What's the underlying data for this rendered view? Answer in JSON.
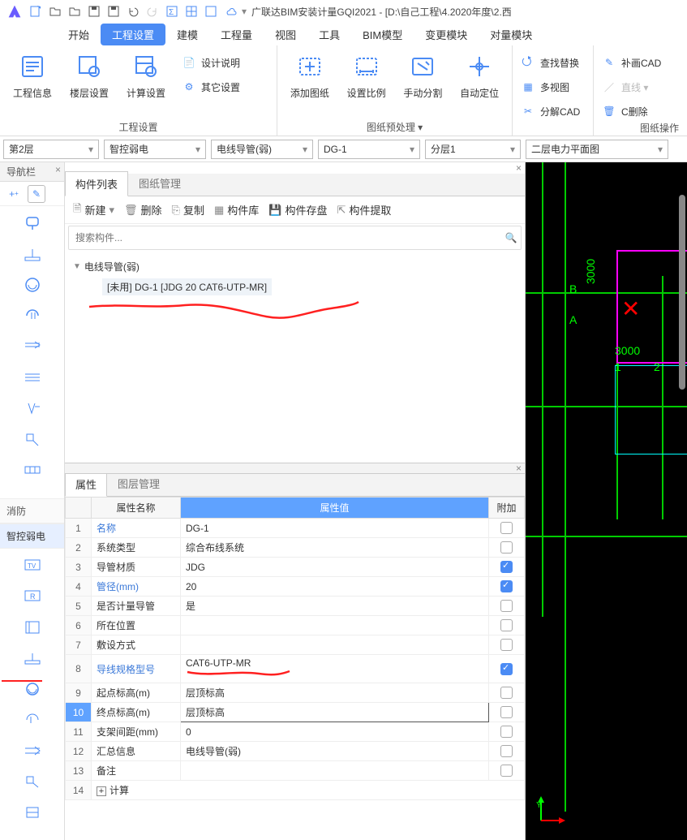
{
  "app": {
    "title": "广联达BIM安装计量GQI2021 - [D:\\自己工程\\4.2020年度\\2.西"
  },
  "menu": {
    "items": [
      "开始",
      "工程设置",
      "建模",
      "工程量",
      "视图",
      "工具",
      "BIM模型",
      "变更模块",
      "对量模块"
    ],
    "active_index": 1
  },
  "ribbon": {
    "group1": {
      "big": [
        {
          "label": "工程信息"
        },
        {
          "label": "楼层设置"
        },
        {
          "label": "计算设置"
        }
      ],
      "small": [
        {
          "label": "设计说明"
        },
        {
          "label": "其它设置"
        }
      ],
      "caption": "工程设置"
    },
    "group2": {
      "big": [
        {
          "label": "添加图纸"
        },
        {
          "label": "设置比例"
        },
        {
          "label": "手动分割"
        },
        {
          "label": "自动定位"
        }
      ],
      "caption": "图纸预处理 ▾"
    },
    "group3": {
      "small": [
        {
          "label": "查找替换"
        },
        {
          "label": "多视图"
        },
        {
          "label": "分解CAD"
        }
      ]
    },
    "group4": {
      "small": [
        {
          "label": "补画CAD"
        },
        {
          "label": "直线 ▾",
          "disabled": true
        },
        {
          "label": "C删除"
        }
      ],
      "caption": "图纸操作"
    }
  },
  "combos": {
    "c1": "第2层",
    "c2": "智控弱电",
    "c3": "电线导管(弱)",
    "c4": "DG-1",
    "c5": "分层1",
    "c6": "二层电力平面图"
  },
  "left_rail": {
    "title": "导航栏",
    "section_fire": "消防",
    "section_weak": "智控弱电"
  },
  "component_list": {
    "tabs": [
      "构件列表",
      "图纸管理"
    ],
    "toolbar": {
      "new": "新建",
      "del": "删除",
      "copy": "复制",
      "lib": "构件库",
      "save": "构件存盘",
      "extract": "构件提取"
    },
    "search_placeholder": "搜索构件...",
    "tree_root": "电线导管(弱)",
    "tree_leaf": "[未用] DG-1 [JDG 20 CAT6-UTP-MR]"
  },
  "props": {
    "tabs": [
      "属性",
      "图层管理"
    ],
    "headers": {
      "name": "属性名称",
      "value": "属性值",
      "att": "附加"
    },
    "rows": [
      {
        "idx": "1",
        "name": "名称",
        "val": "DG-1",
        "link": true,
        "chk": false
      },
      {
        "idx": "2",
        "name": "系统类型",
        "val": "综合布线系统",
        "chk": false
      },
      {
        "idx": "3",
        "name": "导管材质",
        "val": "JDG",
        "chk": true
      },
      {
        "idx": "4",
        "name": "管径(mm)",
        "val": "20",
        "link": true,
        "chk": true
      },
      {
        "idx": "5",
        "name": "是否计量导管",
        "val": "是",
        "chk": false
      },
      {
        "idx": "6",
        "name": "所在位置",
        "val": "",
        "chk": false
      },
      {
        "idx": "7",
        "name": "敷设方式",
        "val": "",
        "chk": false
      },
      {
        "idx": "8",
        "name": "导线规格型号",
        "val": "CAT6-UTP-MR",
        "link": true,
        "chk": true,
        "red": true
      },
      {
        "idx": "9",
        "name": "起点标高(m)",
        "val": "层顶标高",
        "chk": false
      },
      {
        "idx": "10",
        "name": "终点标高(m)",
        "val": "层顶标高",
        "chk": false,
        "hl": true,
        "boxed": true
      },
      {
        "idx": "11",
        "name": "支架间距(mm)",
        "val": "0",
        "chk": false
      },
      {
        "idx": "12",
        "name": "汇总信息",
        "val": "电线导管(弱)",
        "chk": false
      },
      {
        "idx": "13",
        "name": "备注",
        "val": "",
        "chk": false
      }
    ],
    "calc_row": {
      "idx": "14",
      "label": "计算"
    }
  },
  "viewport": {
    "label_B": "B",
    "label_A": "A",
    "dim1": "3000",
    "dim2": "3000",
    "axis1": "1",
    "axis2": "2"
  }
}
